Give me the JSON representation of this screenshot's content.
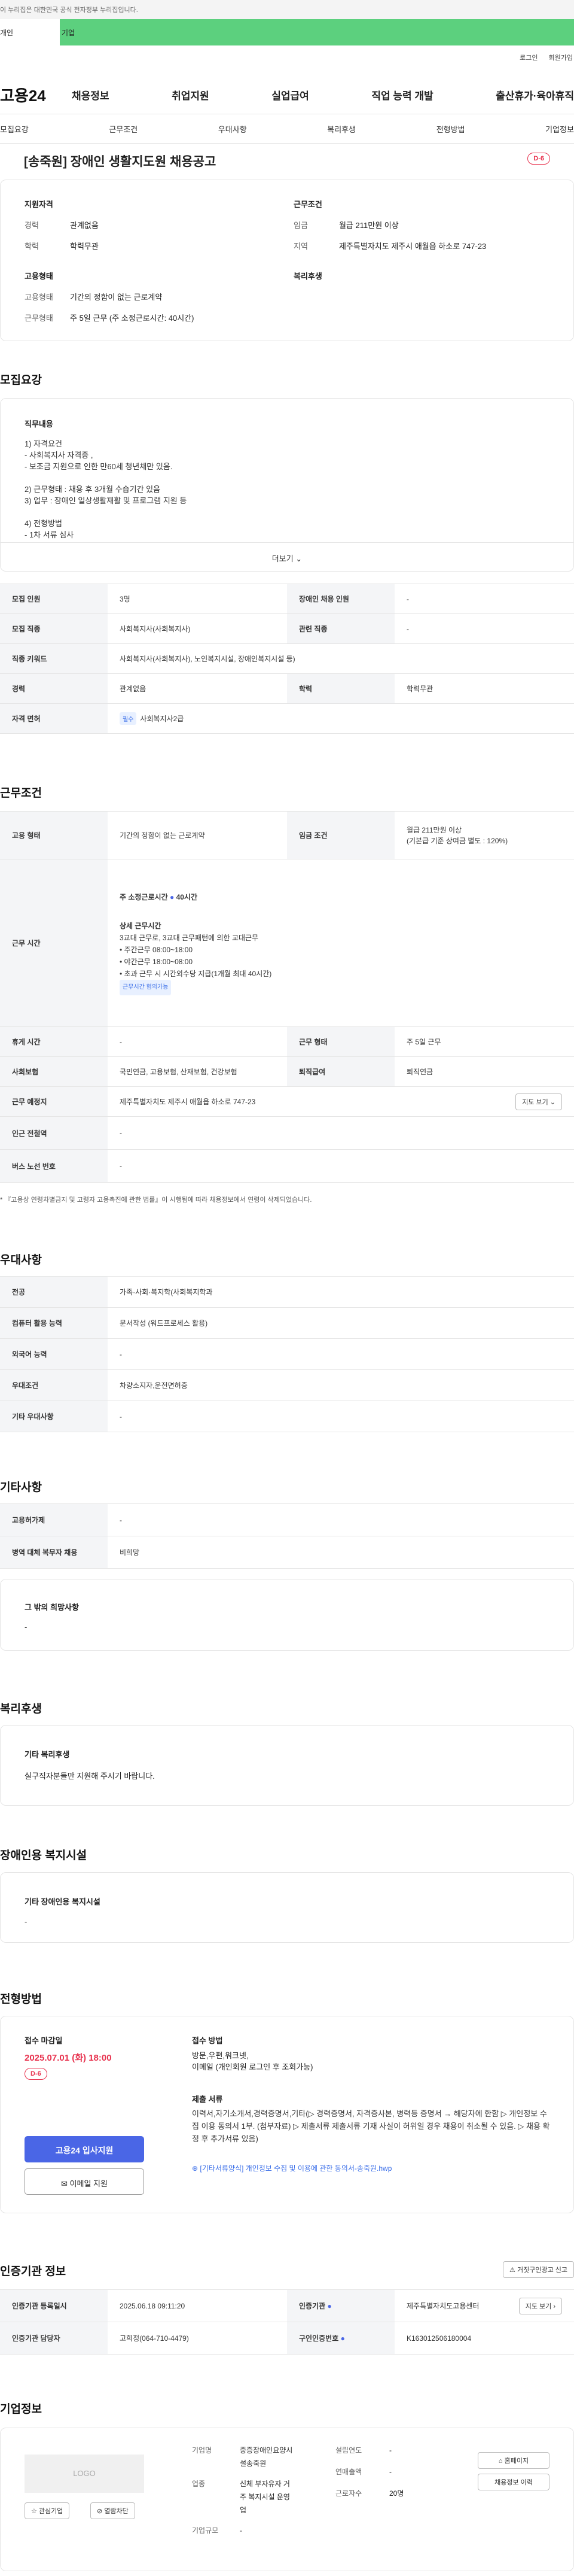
{
  "gov_banner": "이 누리집은 대한민국 공식 전자정부 누리집입니다.",
  "tabs": {
    "personal": "개인",
    "company": "기업"
  },
  "util": [
    "로그인",
    "회원가입"
  ],
  "logo": "고용24",
  "gnb": [
    "채용정보",
    "취업지원",
    "실업급여",
    "직업 능력 개발",
    "출산휴가·육아휴직"
  ],
  "subnav": [
    "모집요강",
    "근무조건",
    "우대사항",
    "복리후생",
    "전형방법",
    "기업정보"
  ],
  "job": {
    "title": "[송죽원] 장애인 생활지도원 채용공고",
    "dday": "D-6"
  },
  "summary": {
    "qual_title": "지원자격",
    "career_k": "경력",
    "career_v": "관계없음",
    "edu_k": "학력",
    "edu_v": "학력무관",
    "work_title": "근무조건",
    "wage_k": "임금",
    "wage_v": "월급 211만원 이상",
    "area_k": "지역",
    "area_v": "제주특별자치도 제주시 애월읍 하소로 747-23",
    "emp_title": "고용형태",
    "emp_k": "고용형태",
    "emp_v": "기간의 정함이 없는 근로계약",
    "shift_k": "근무형태",
    "shift_v": "주 5일 근무 (주 소정근로시간: 40시간)",
    "welfare_title": "복리후생"
  },
  "recruit": {
    "heading": "모집요강",
    "duty_title": "직무내용",
    "duty_lines": [
      "1) 자격요건",
      "- 사회복지사 자격증 ,",
      "- 보조금 지원으로 인한 만60세 청년채만 있음.",
      "",
      "2) 근무형태 : 채용 후 3개월 수습기간 있음",
      "3) 업무 : 장애인 일상생활재활 및 프로그램 지원 등",
      "",
      "4) 전형방법",
      "- 1차 서류 심사"
    ],
    "more": "더보기",
    "rows": {
      "count_k": "모집 인원",
      "count_v": "3명",
      "disabled_k": "장애인 채용 인원",
      "disabled_v": "-",
      "job_k": "모집 직종",
      "job_v": "사회복지사(사회복지사)",
      "related_k": "관련 직종",
      "related_v": "-",
      "kw_k": "직종 키워드",
      "kw_v": "사회복지사(사회복지사), 노인복지시설, 장애인복지시설 등)",
      "career_k": "경력",
      "career_v": "관계없음",
      "edu_k": "학력",
      "edu_v": "학력무관",
      "license_k": "자격 면허",
      "license_badge": "필수",
      "license_v": "사회복지사2급"
    }
  },
  "work": {
    "heading": "근무조건",
    "emp_k": "고용 형태",
    "emp_v": "기간의 정함이 없는 근로계약",
    "wage_k": "임금 조건",
    "wage_v1": "월급 211만원 이상",
    "wage_v2": "(기본급 기준 상여금 별도 : 120%)",
    "hours_k": "근무 시간",
    "hours_head": "주 소정근로시간",
    "hours_val": "40시간",
    "detail_title": "상세 근무시간",
    "detail_lines": [
      "3교대 근무로, 3교대 근무패턴에 의한 교대근무",
      "• 주간근무 08:00~18:00",
      "• 야간근무 18:00~08:00",
      "• 초과 근무 시 시간외수당 지급(1개월 최대 40시간)"
    ],
    "detail_badge": "근무시간 협의가능",
    "rest_k": "휴게 시간",
    "rest_v": "-",
    "type_k": "근무 형태",
    "type_v": "주 5일 근무",
    "ins_k": "사회보험",
    "ins_v": "국민연금, 고용보험, 산재보험, 건강보험",
    "ret_k": "퇴직급여",
    "ret_v": "퇴직연금",
    "place_k": "근무 예정지",
    "place_v": "제주특별자치도 제주시 애월읍 하소로 747-23",
    "map_btn": "지도 보기 ⌄",
    "subway_k": "인근 전철역",
    "subway_v": "-",
    "bus_k": "버스 노선 번호",
    "bus_v": "-",
    "notice": "* 『고용상 연령차별금지 및 고령자 고용촉진에 관한 법률』이 시행됨에 따라 채용정보에서 연령이 삭제되었습니다."
  },
  "pref": {
    "heading": "우대사항",
    "major_k": "전공",
    "major_v": "가족·사회·복지학(사회복지학과",
    "pc_k": "컴퓨터 활용 능력",
    "pc_v": "문서작성 (워드프로세스 활용)",
    "lang_k": "외국어 능력",
    "lang_v": "-",
    "cond_k": "우대조건",
    "cond_v": "차량소지자,운전면허증",
    "etc_k": "기타 우대사항",
    "etc_v": "-"
  },
  "other": {
    "heading": "기타사항",
    "ins_k": "고용허가제",
    "ins_v": "-",
    "army_k": "병역 대체 복무자 채용",
    "army_v": "비희망",
    "wish_title": "그 밖의 희망사항",
    "wish_v": "-"
  },
  "welfare": {
    "heading": "복리후생",
    "title": "기타 복리후생",
    "text": "실구직자분들만 지원해 주시기 바랍니다."
  },
  "disabled": {
    "heading": "장애인용 복지시설",
    "title": "기타 장애인용 복지시설",
    "text": "-"
  },
  "process": {
    "heading": "전형방법",
    "deadline_title": "접수 마감일",
    "deadline": "2025.07.01 (화) 18:00",
    "dday": "D-6",
    "apply_btn": "고용24 입사지원",
    "email_btn": "이메일 지원",
    "method_title": "접수 방법",
    "method_lines": [
      "방문,우편,워크넷,",
      "이메일 (개인회원 로그인 후 조회가능)"
    ],
    "docs_title": "제출 서류",
    "docs_text": "이력서,자기소개서,경력증명서,기타(▷ 경력증명서, 자격증사본, 병력등 증명서 → 해당자에 한함 ▷ 개인정보 수집 이용 동의서 1부. (첨부자료) ▷ 제출서류 제출서류 기재 사실이 허위일 경우 채용이 취소될 수 있음. ▷ 채용 확정 후 추가서류 있음)",
    "docs_link": "[기타서류양식] 개인정보 수집 및 이용에 관한 동의서-송죽원.hwp"
  },
  "agency": {
    "heading": "인증기관 정보",
    "report_btn": "거짓구인광고 신고",
    "reg_k": "인증기관 등록일시",
    "reg_v": "2025.06.18 09:11:20",
    "name_k": "인증기관",
    "name_v": "제주특별자치도고용센터",
    "map_btn": "지도 보기 ›",
    "mgr_k": "인증기관 담당자",
    "mgr_v": "고희정(064-710-4479)",
    "no_k": "구인인증번호",
    "no_v": "K163012506180004"
  },
  "company": {
    "heading": "기업정보",
    "logo": "LOGO",
    "fav_btn": "☆ 관심기업",
    "block_btn": "열람차단",
    "name_k": "기업명",
    "name_v1": "중증장애인요양시",
    "name_v2": "설송죽원",
    "ind_k": "업종",
    "ind_v1": "신체 부자유자 거",
    "ind_v2": "주 복지시설 운영",
    "ind_v3": "업",
    "size_k": "기업규모",
    "size_v": "-",
    "year_k": "설립연도",
    "year_v": "-",
    "sales_k": "연매출액",
    "sales_v": "-",
    "emp_k": "근로자수",
    "emp_v": "20명",
    "home_btn": "홈페이지",
    "info_btn": "채용정보 이력"
  },
  "colors": {
    "accent": "#4a66e6",
    "green": "#5cd07e",
    "dday": "#e8334f"
  }
}
